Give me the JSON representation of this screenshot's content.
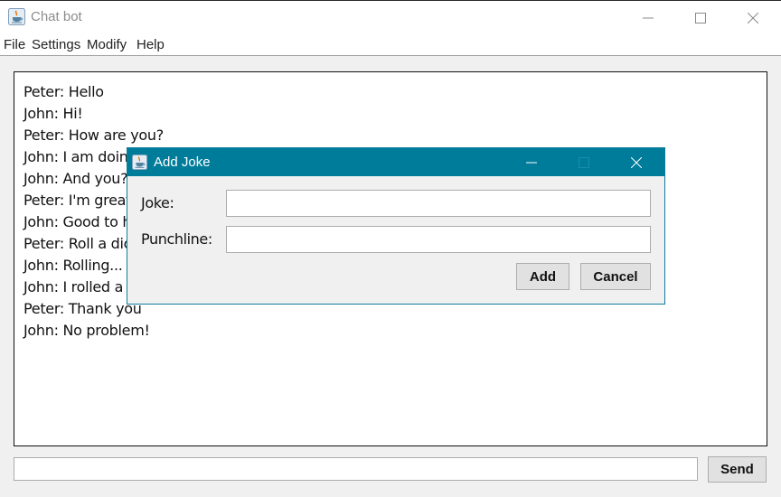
{
  "window": {
    "title": "Chat bot",
    "icon": "java-cup-icon",
    "controls": [
      "minimize-icon",
      "maximize-icon",
      "close-icon"
    ]
  },
  "menu": {
    "items": [
      {
        "label": "File"
      },
      {
        "label": "Settings"
      },
      {
        "label": "Modify"
      },
      {
        "label": "Help"
      }
    ]
  },
  "chat": {
    "lines": [
      "Peter: Hello",
      "John: Hi!",
      "Peter: How are you?",
      "John: I am doing well",
      "John: And you?",
      "Peter: I'm great",
      "John: Good to hear",
      "Peter: Roll a dice",
      "John: Rolling...",
      "John: I rolled a",
      "Peter: Thank you",
      "John: No problem!"
    ]
  },
  "input": {
    "value": "",
    "send_label": "Send"
  },
  "dialog": {
    "title": "Add Joke",
    "icon": "java-cup-icon",
    "joke_label": "Joke:",
    "joke_value": "",
    "punchline_label": "Punchline:",
    "punchline_value": "",
    "add_label": "Add",
    "cancel_label": "Cancel",
    "accent_color": "#007c9b"
  }
}
